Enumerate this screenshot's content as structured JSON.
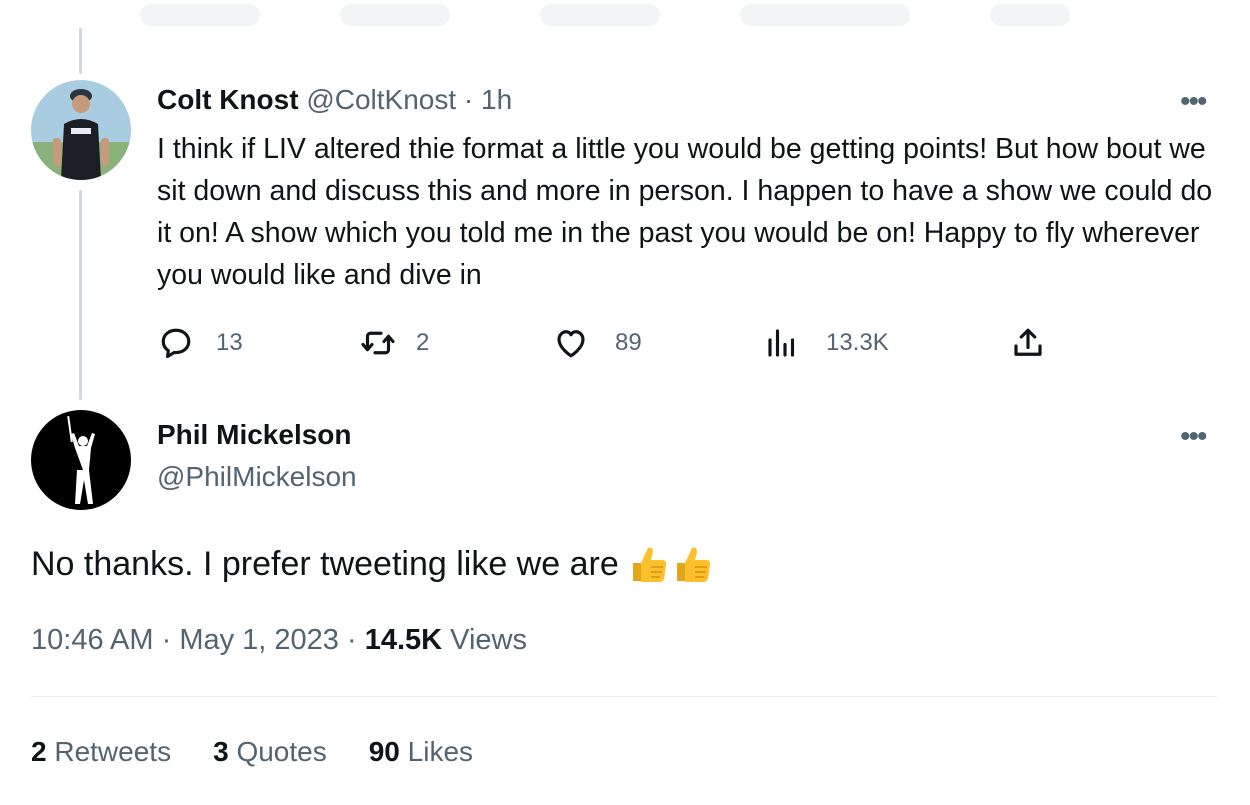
{
  "reply": {
    "author_name": "Colt Knost",
    "author_handle": "@ColtKnost",
    "separator": " · ",
    "time_ago": "1h",
    "text": "I think if LIV altered thie format a little you would be getting points! But how bout we sit down and discuss this and more in person. I happen to have a show we could do it on! A show which you told me in the past you would be on! Happy to fly wherever you would like and dive in",
    "more_label": "•••",
    "actions": {
      "replies": "13",
      "retweets": "2",
      "likes": "89",
      "views": "13.3K"
    },
    "icons": [
      "reply-icon",
      "retweet-icon",
      "like-icon",
      "views-icon",
      "share-icon"
    ]
  },
  "main": {
    "author_name": "Phil Mickelson",
    "author_handle": "@PhilMickelson",
    "more_label": "•••",
    "text": "No thanks. I prefer tweeting like we are",
    "emoji": [
      "thumbs-up-icon",
      "thumbs-up-icon"
    ],
    "time": "10:46 AM",
    "date": "May 1, 2023",
    "separator": " · ",
    "views_count": "14.5K",
    "views_label": "Views"
  },
  "stats": {
    "retweets_count": "2",
    "retweets_label": "Retweets",
    "quotes_count": "3",
    "quotes_label": "Quotes",
    "likes_count": "90",
    "likes_label": "Likes"
  },
  "colors": {
    "text": "#0f1419",
    "muted": "#536471",
    "thread_line": "#cfd9de",
    "divider": "#e6ecf0",
    "emoji_yellow": "#fbc02d"
  }
}
